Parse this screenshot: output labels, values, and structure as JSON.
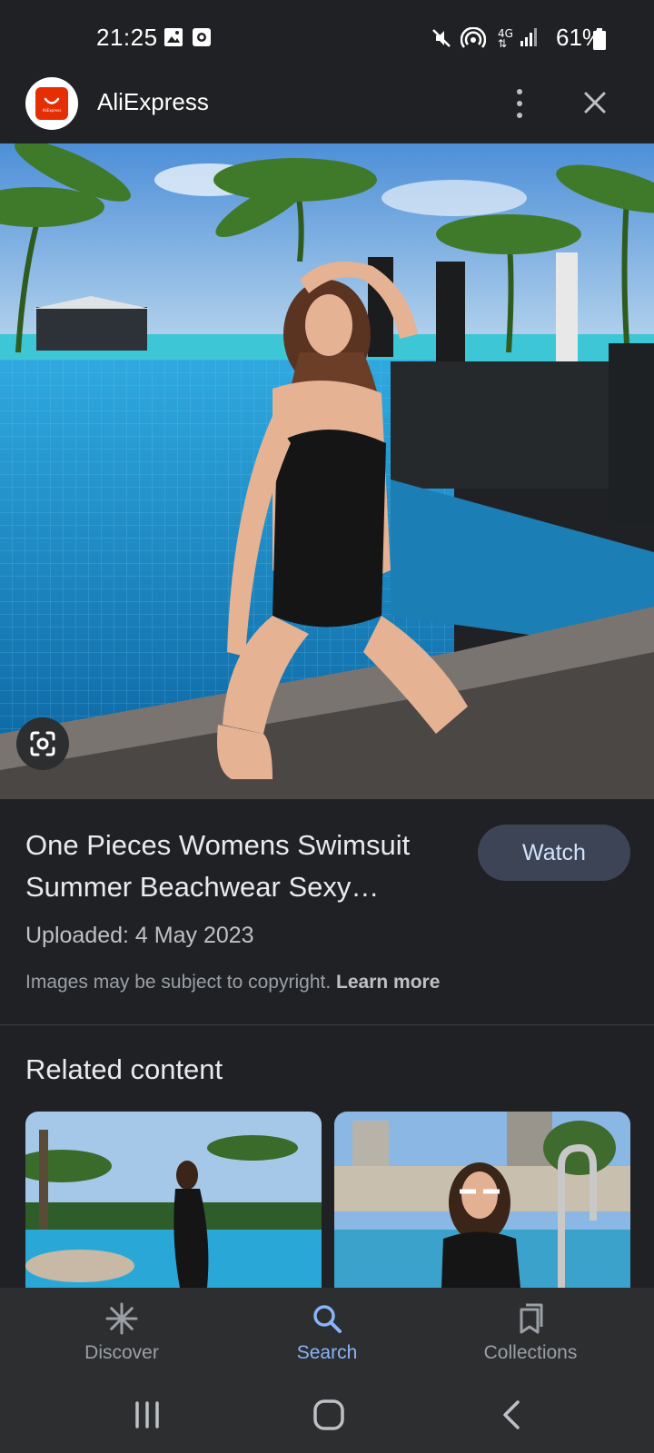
{
  "status_bar": {
    "time": "21:25",
    "battery": "61%"
  },
  "header": {
    "app_name": "AliExpress",
    "logo_text": "AliExpress"
  },
  "result": {
    "title": "One Pieces Womens Swimsuit Summer Beachwear Sexy…",
    "watch_label": "Watch",
    "uploaded": "Uploaded: 4 May 2023",
    "copyright_text": "Images may be subject to copyright.",
    "learn_more": "Learn more"
  },
  "related": {
    "title": "Related content"
  },
  "bottom_nav": {
    "items": [
      {
        "label": "Discover",
        "icon": "asterisk-icon"
      },
      {
        "label": "Search",
        "icon": "search-icon"
      },
      {
        "label": "Collections",
        "icon": "bookmarks-icon"
      }
    ],
    "active": "Search"
  },
  "colors": {
    "background": "#202124",
    "accent": "#8ab4f8",
    "brand": "#e62e04"
  }
}
